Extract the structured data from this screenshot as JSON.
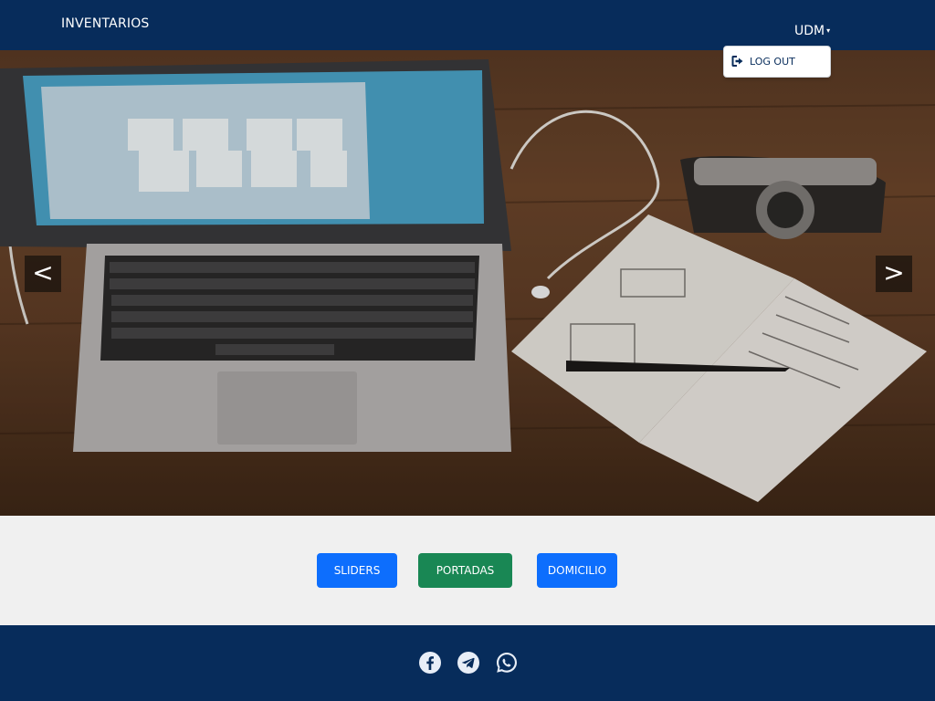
{
  "navbar": {
    "brand": "INVENTARIOS",
    "user_menu": "UDM",
    "caret": "▾"
  },
  "dropdown": {
    "logout_label": "LOG OUT",
    "logout_icon": "sign-out-icon"
  },
  "carousel": {
    "prev_label": "<",
    "next_label": ">"
  },
  "actions": {
    "sliders_label": "SLIDERS",
    "portadas_label": "PORTADAS",
    "domicilio_label": "DOMICILIO"
  },
  "footer": {
    "social": [
      "facebook-icon",
      "telegram-icon",
      "whatsapp-icon"
    ]
  },
  "colors": {
    "navbar": "#072c5b",
    "primary": "#0d6efd",
    "success": "#198754",
    "background": "#f0f0f0"
  }
}
